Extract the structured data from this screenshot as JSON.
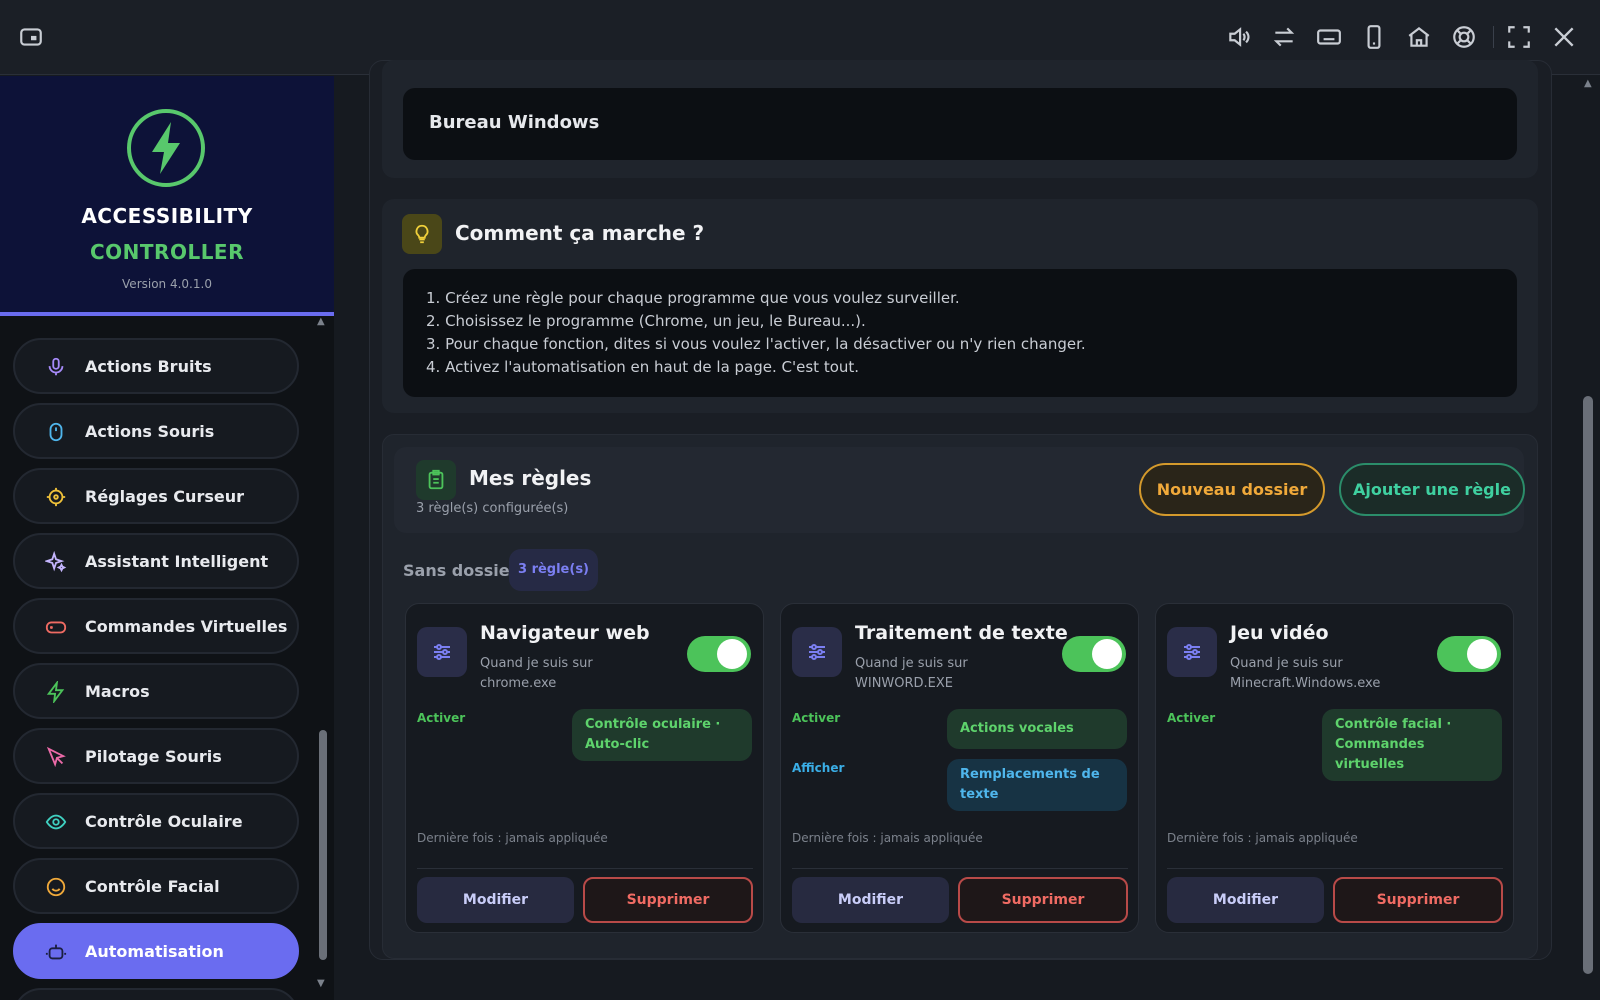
{
  "topbar": {
    "left_icon": "window-icon",
    "right_icons": [
      "volume-icon",
      "swap-icon",
      "keyboard-icon",
      "phone-icon",
      "home-icon",
      "lifebuoy-icon",
      "fullscreen-icon",
      "close-icon"
    ]
  },
  "brand": {
    "line1": "ACCESSIBILITY",
    "line2": "CONTROLLER",
    "version": "Version 4.0.1.0",
    "accent": "#58c86c"
  },
  "sidebar": {
    "items": [
      {
        "label": "Actions Bruits",
        "icon": "microphone-icon",
        "color": "#a78bfa"
      },
      {
        "label": "Actions Souris",
        "icon": "mouse-icon",
        "color": "#4fb6ec"
      },
      {
        "label": "Réglages Curseur",
        "icon": "crosshair-icon",
        "color": "#f0c23a"
      },
      {
        "label": "Assistant Intelligent",
        "icon": "sparkles-icon",
        "color": "#c4b5fd"
      },
      {
        "label": "Commandes Virtuelles",
        "icon": "gamepad-icon",
        "color": "#ef6b63"
      },
      {
        "label": "Macros",
        "icon": "bolt-icon",
        "color": "#4cc35a"
      },
      {
        "label": "Pilotage Souris",
        "icon": "pointer-icon",
        "color": "#ec6aa8"
      },
      {
        "label": "Contrôle Oculaire",
        "icon": "eye-icon",
        "color": "#3fd0c0"
      },
      {
        "label": "Contrôle Facial",
        "icon": "smile-icon",
        "color": "#f0a93a"
      },
      {
        "label": "Automatisation",
        "icon": "robot-icon",
        "color": "#ffffff",
        "active": true
      }
    ]
  },
  "main": {
    "program_value": "Bureau Windows",
    "how": {
      "title": "Comment ça marche ?",
      "lines": [
        "1. Créez une règle pour chaque programme que vous voulez surveiller.",
        "2. Choisissez le programme (Chrome, un jeu, le Bureau...).",
        "3. Pour chaque fonction, dites si vous voulez l'activer, la désactiver ou n'y rien changer.",
        "4. Activez l'automatisation en haut de la page. C'est tout."
      ]
    },
    "rules": {
      "title": "Mes règles",
      "count": "3 règle(s) configurée(s)",
      "new_folder": "Nouveau dossier",
      "add_rule": "Ajouter une règle",
      "folder_name": "Sans dossier",
      "folder_badge": "3 règle(s)",
      "cards": [
        {
          "title": "Navigateur web",
          "sub1": "Quand je suis sur",
          "sub2": "chrome.exe",
          "enabled": true,
          "activate_label": "Activer",
          "activate_chip": "Contrôle oculaire · Auto-clic",
          "last": "Dernière fois : jamais appliquée",
          "edit": "Modifier",
          "delete": "Supprimer"
        },
        {
          "title": "Traitement de texte",
          "sub1": "Quand je suis sur",
          "sub2": "WINWORD.EXE",
          "enabled": true,
          "activate_label": "Activer",
          "activate_chip": "Actions vocales",
          "show_label": "Afficher",
          "show_chip": "Remplacements de texte",
          "last": "Dernière fois : jamais appliquée",
          "edit": "Modifier",
          "delete": "Supprimer"
        },
        {
          "title": "Jeu vidéo",
          "sub1": "Quand je suis sur",
          "sub2": "Minecraft.Windows.exe",
          "enabled": true,
          "activate_label": "Activer",
          "activate_chip": "Contrôle facial · Commandes virtuelles",
          "last": "Dernière fois : jamais appliquée",
          "edit": "Modifier",
          "delete": "Supprimer"
        }
      ]
    }
  }
}
